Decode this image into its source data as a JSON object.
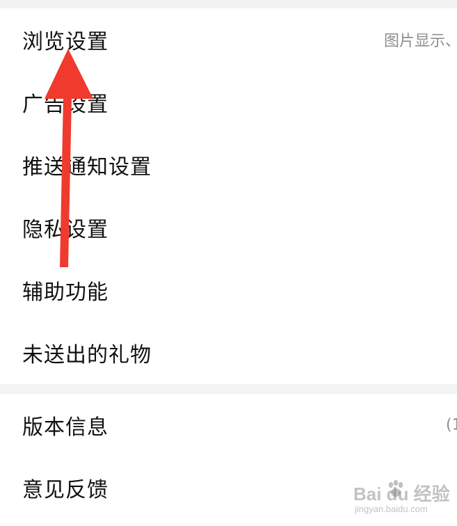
{
  "groups": [
    {
      "items": [
        {
          "label": "浏览设置",
          "value": "图片显示、"
        },
        {
          "label": "广告设置"
        },
        {
          "label": "推送通知设置"
        },
        {
          "label": "隐私设置"
        },
        {
          "label": "辅助功能"
        },
        {
          "label": "未送出的礼物"
        }
      ]
    },
    {
      "items": [
        {
          "label": "版本信息",
          "value": "(1"
        },
        {
          "label": "意见反馈"
        }
      ]
    }
  ],
  "watermark": {
    "brand": "Bai du 经验",
    "domain": "jingyan.baidu.com"
  },
  "colors": {
    "background": "#f2f3f5",
    "card": "#ffffff",
    "label_text": "#111111",
    "secondary_text": "#8e8e93",
    "annotation_arrow": "#f03a2e"
  },
  "icons": {
    "annotation": "red-up-arrow-icon",
    "watermark": "paw-icon"
  }
}
